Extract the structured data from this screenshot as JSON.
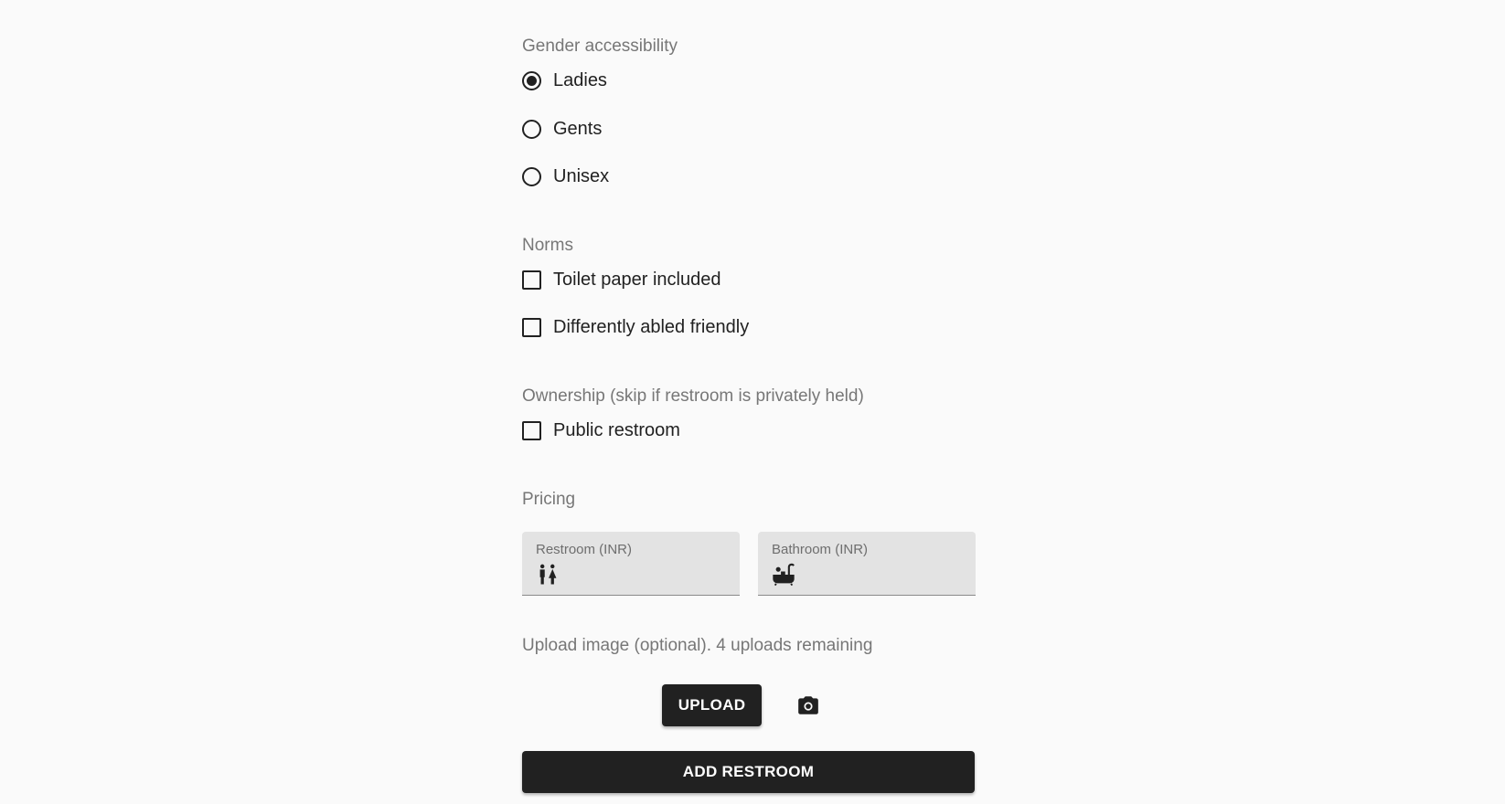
{
  "gender": {
    "label": "Gender accessibility",
    "options": [
      {
        "label": "Ladies",
        "selected": true
      },
      {
        "label": "Gents",
        "selected": false
      },
      {
        "label": "Unisex",
        "selected": false
      }
    ]
  },
  "norms": {
    "label": "Norms",
    "options": [
      {
        "label": "Toilet paper included",
        "checked": false
      },
      {
        "label": "Differently abled friendly",
        "checked": false
      }
    ]
  },
  "ownership": {
    "label": "Ownership (skip if restroom is privately held)",
    "options": [
      {
        "label": "Public restroom",
        "checked": false
      }
    ]
  },
  "pricing": {
    "label": "Pricing",
    "restroom": {
      "label": "Restroom (INR)",
      "value": "",
      "icon": "wc-icon"
    },
    "bathroom": {
      "label": "Bathroom (INR)",
      "value": "",
      "icon": "bathtub-icon"
    }
  },
  "upload": {
    "label": "Upload image (optional). 4 uploads remaining",
    "button_label": "UPLOAD",
    "camera_icon": "camera-icon"
  },
  "submit": {
    "label": "ADD RESTROOM"
  },
  "colors": {
    "background": "#fafafa",
    "primary": "#212121",
    "muted_label": "#777777",
    "field_fill": "#e3e3e3"
  }
}
